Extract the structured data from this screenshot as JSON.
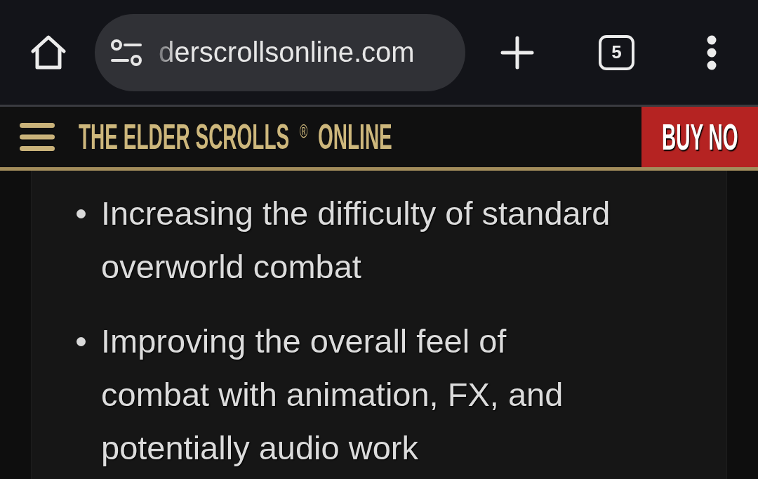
{
  "browser": {
    "url": "derscrollsonline.com",
    "tab_count": "5"
  },
  "site_header": {
    "title": "THE ELDER SCROLLS $^{®}$ ONLINE",
    "buy_button": "BUY NO"
  },
  "list": {
    "items": [
      "Increasing the difficulty of standard overworld combat",
      "Improving the overall feel of combat with animation, FX, and potentially audio work"
    ]
  }
}
